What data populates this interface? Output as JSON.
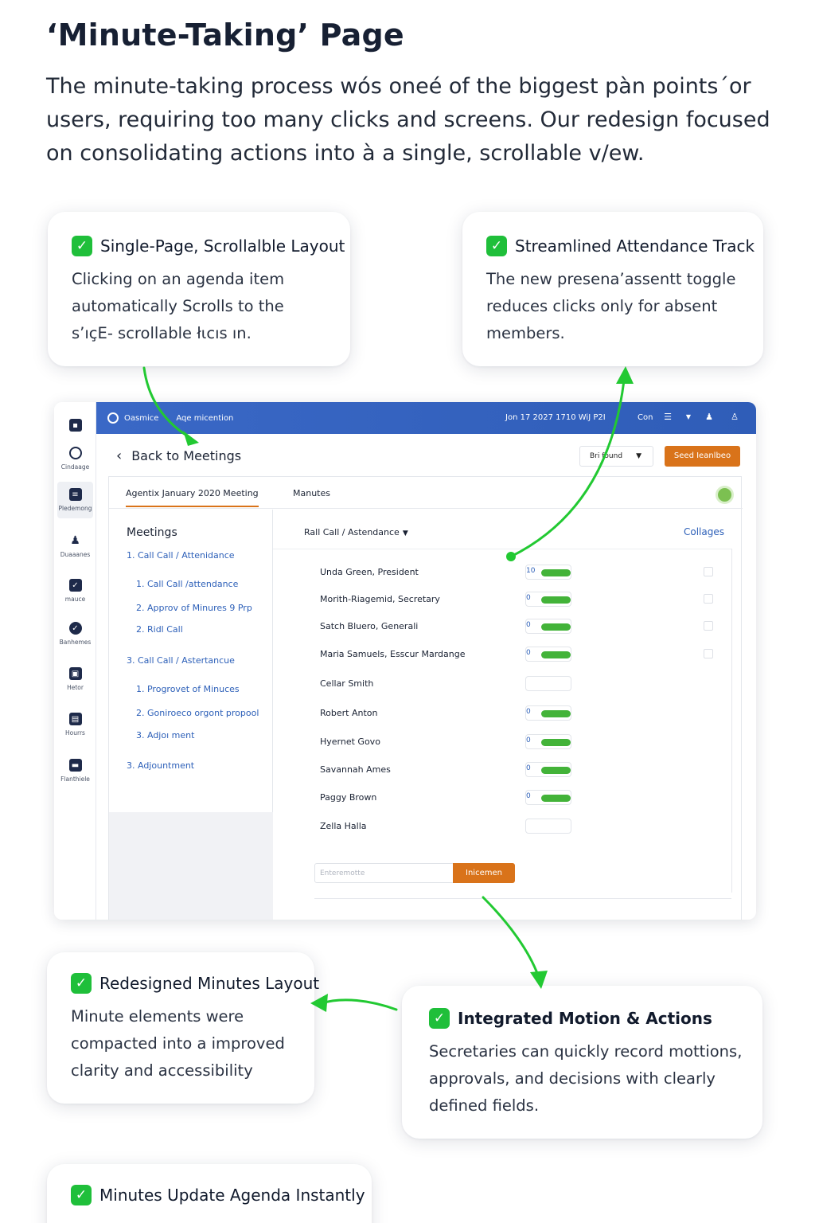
{
  "page": {
    "title": "‘Minute-Taking’ Page",
    "intro": "The minute-taking process wós oneé of the biggest pàn points´or users, requiring too many clicks and screens. Our redesign focused on consolidating actions into à a single, scrollable v/ew."
  },
  "colors": {
    "accent": "#1fbf3a",
    "brand": "#3a68c6",
    "action": "#d9731a",
    "link": "#2c5fb8"
  },
  "cards": [
    {
      "title": "Single-Page, Scrollalble Layout",
      "text": "Clicking on an agenda item automatically Scrolls to the ѕ’ıçЕ- scrollable łιcıs ın."
    },
    {
      "title": "Streamlined Attendance Track",
      "text": "The new presena’assentt toggle reduces clicks only for absent members."
    },
    {
      "title": "Redesigned Minutes Layout",
      "text": "Minute elements were compacted into a improved clarity and accessibility"
    },
    {
      "title": "Integrated Motion & Actions",
      "text": "Secretaries can quickly record mottions, approvals, and decisions with clearly defined fields."
    },
    {
      "title": "Minutes Update Agenda Instantly",
      "text": ""
    }
  ],
  "app": {
    "topbar": {
      "brand": "Oasmice",
      "app_name": "Aqe micention",
      "datetime": "Jon 17 2027 1710 WiJ P2I",
      "user": "Con"
    },
    "rail": [
      {
        "label": "",
        "icon": "app-icon"
      },
      {
        "label": "Cindaage",
        "icon": "dashboard-icon"
      },
      {
        "label": "Pledemong",
        "icon": "meetings-icon"
      },
      {
        "label": "Duaaanes",
        "icon": "members-icon"
      },
      {
        "label": "mauce",
        "icon": "tasks-icon"
      },
      {
        "label": "Banhemes",
        "icon": "approvals-icon"
      },
      {
        "label": "Hetor",
        "icon": "documents-icon"
      },
      {
        "label": "Hourrs",
        "icon": "reports-icon"
      },
      {
        "label": "Flanthiele",
        "icon": "billing-icon"
      }
    ],
    "back_label": "Back to Meetings",
    "select_value": "Bri found",
    "send_label": "Seed Ieanlbeo",
    "tabs": [
      "Agentix January 2020 Meeting",
      "Manutes"
    ],
    "sidenav": {
      "heading": "Meetings",
      "items": [
        "1. Call Call / Attenidance",
        "1. Call Call /attendance",
        "2. Approv of Minures 9 Prp",
        "2. Ridl Call",
        "3. Call Call / Astertancue",
        "1. Progrovet of Minuces",
        "2. Goniroeco orgont propool",
        "3. Adjoı ment",
        "3. Adjountment"
      ]
    },
    "roll_call": {
      "heading": "Rall Call / Astendance",
      "link": "Collages"
    },
    "attendees": [
      {
        "name": "Unda Green, President",
        "num": "10",
        "present": true,
        "checkbox": true
      },
      {
        "name": "Morith-Riagemid, Secretary",
        "num": "0",
        "present": true,
        "checkbox": true
      },
      {
        "name": "Satch Bluero, Generali",
        "num": "0",
        "present": true,
        "checkbox": true
      },
      {
        "name": "Maria Samuels, Esscur Mardange",
        "num": "0",
        "present": true,
        "checkbox": true
      },
      {
        "name": "Cellar Smith",
        "num": "",
        "present": false,
        "checkbox": false
      },
      {
        "name": "Robert Anton",
        "num": "0",
        "present": true,
        "checkbox": false
      },
      {
        "name": "Hyernet Govo",
        "num": "0",
        "present": true,
        "checkbox": false
      },
      {
        "name": "Savannah Ames",
        "num": "0",
        "present": true,
        "checkbox": false
      },
      {
        "name": "Paggy Brown",
        "num": "0",
        "present": true,
        "checkbox": false
      },
      {
        "name": "Zella Halla",
        "num": "",
        "present": false,
        "checkbox": false
      }
    ],
    "motion": {
      "placeholder": "Enteremotte",
      "button": "Inicemen"
    }
  }
}
